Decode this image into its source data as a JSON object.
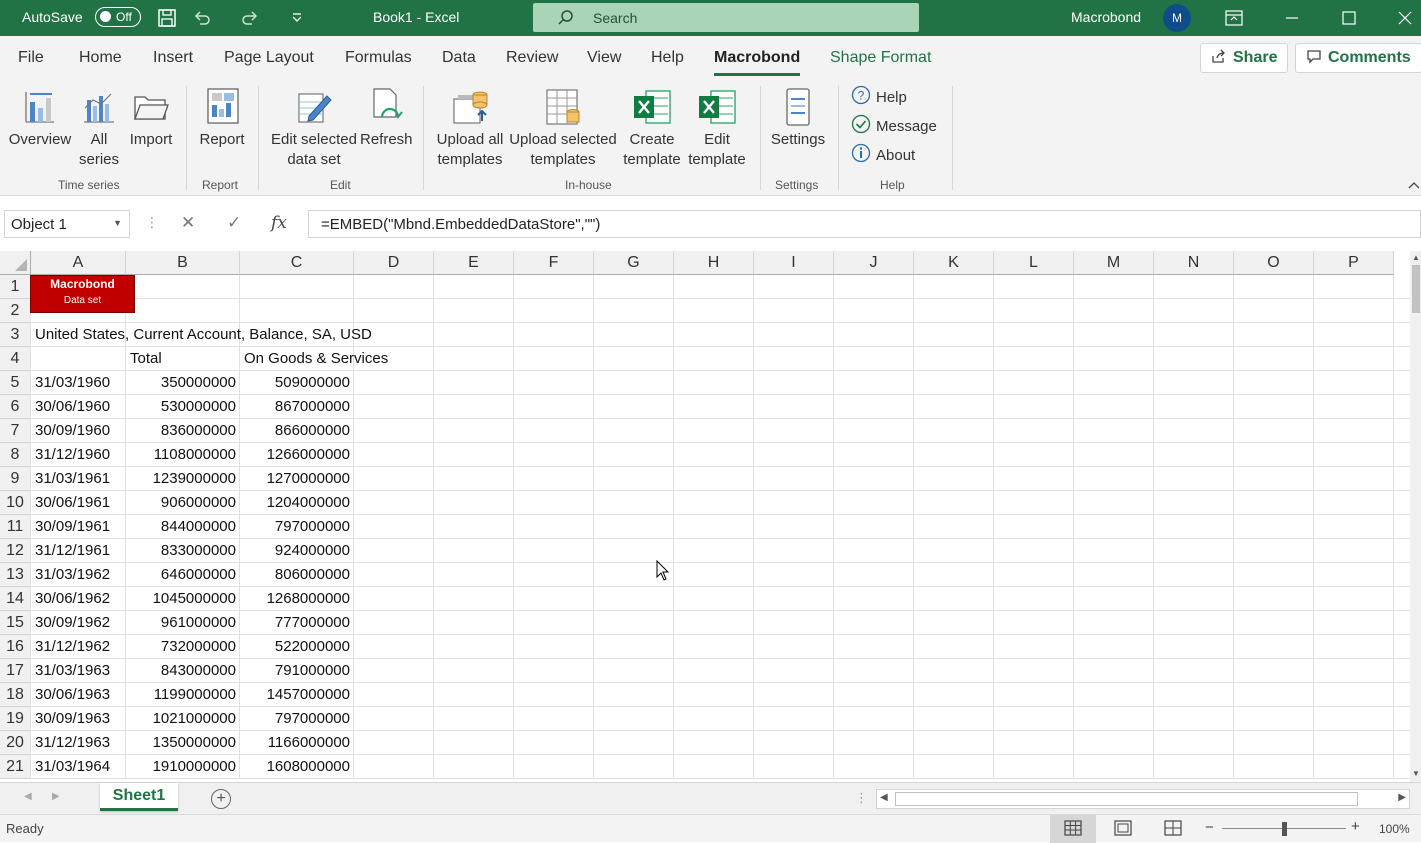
{
  "titlebar": {
    "autosave_label": "AutoSave",
    "autosave_state": "Off",
    "doc_title": "Book1  -  Excel",
    "search_placeholder": "Search",
    "user_name": "Macrobond",
    "user_initial": "M"
  },
  "menu": {
    "items": [
      "File",
      "Home",
      "Insert",
      "Page Layout",
      "Formulas",
      "Data",
      "Review",
      "View",
      "Help",
      "Macrobond",
      "Shape Format"
    ],
    "active": "Macrobond",
    "share_label": "Share",
    "comments_label": "Comments"
  },
  "ribbon": {
    "overview": "Overview",
    "all_series_1": "All",
    "all_series_2": "series",
    "import": "Import",
    "report": "Report",
    "edit_selected_1": "Edit selected",
    "edit_selected_2": "data set",
    "refresh": "Refresh",
    "upload_all_1": "Upload all",
    "upload_all_2": "templates",
    "upload_selected_1": "Upload selected",
    "upload_selected_2": "templates",
    "create_template_1": "Create",
    "create_template_2": "template",
    "edit_template_1": "Edit",
    "edit_template_2": "template",
    "settings": "Settings",
    "help": "Help",
    "message": "Message",
    "about": "About",
    "groups": {
      "time_series": "Time series",
      "report": "Report",
      "edit": "Edit",
      "in_house": "In-house",
      "settings": "Settings",
      "help": "Help"
    }
  },
  "formula_bar": {
    "name_box": "Object 1",
    "fx": "fx",
    "formula": "=EMBED(\"Mbnd.EmbeddedDataStore\",\"\")"
  },
  "grid": {
    "columns": [
      "A",
      "B",
      "C",
      "D",
      "E",
      "F",
      "G",
      "H",
      "I",
      "J",
      "K",
      "L",
      "M",
      "N",
      "O",
      "P"
    ],
    "row_numbers": [
      "1",
      "2",
      "3",
      "4",
      "5",
      "6",
      "7",
      "8",
      "9",
      "10",
      "11",
      "12",
      "13",
      "14",
      "15",
      "16",
      "17",
      "18",
      "19",
      "20",
      "21"
    ],
    "embedded_object_title": "Macrobond",
    "embedded_object_subtitle": "Data set",
    "series_title": "United States, Current Account, Balance, SA, USD",
    "header_total": "Total",
    "header_goods": "On Goods & Services",
    "rows": [
      [
        "31/03/1960",
        "350000000",
        "509000000"
      ],
      [
        "30/06/1960",
        "530000000",
        "867000000"
      ],
      [
        "30/09/1960",
        "836000000",
        "866000000"
      ],
      [
        "31/12/1960",
        "1108000000",
        "1266000000"
      ],
      [
        "31/03/1961",
        "1239000000",
        "1270000000"
      ],
      [
        "30/06/1961",
        "906000000",
        "1204000000"
      ],
      [
        "30/09/1961",
        "844000000",
        "797000000"
      ],
      [
        "31/12/1961",
        "833000000",
        "924000000"
      ],
      [
        "31/03/1962",
        "646000000",
        "806000000"
      ],
      [
        "30/06/1962",
        "1045000000",
        "1268000000"
      ],
      [
        "30/09/1962",
        "961000000",
        "777000000"
      ],
      [
        "31/12/1962",
        "732000000",
        "522000000"
      ],
      [
        "31/03/1963",
        "843000000",
        "791000000"
      ],
      [
        "30/06/1963",
        "1199000000",
        "1457000000"
      ],
      [
        "30/09/1963",
        "1021000000",
        "797000000"
      ],
      [
        "31/12/1963",
        "1350000000",
        "1166000000"
      ],
      [
        "31/03/1964",
        "1910000000",
        "1608000000"
      ]
    ]
  },
  "sheets": {
    "active": "Sheet1"
  },
  "status": {
    "text": "Ready",
    "zoom": "100%"
  },
  "colors": {
    "accent": "#217346",
    "object_red": "#c00000"
  }
}
